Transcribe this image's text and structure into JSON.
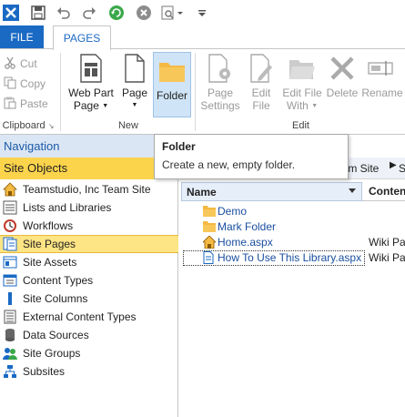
{
  "tabs": {
    "file": "FILE",
    "pages": "PAGES"
  },
  "clipboard": {
    "cut": "Cut",
    "copy": "Copy",
    "paste": "Paste",
    "label": "Clipboard"
  },
  "new_group": {
    "web_part_page_1": "Web Part",
    "web_part_page_2": "Page",
    "page": "Page",
    "folder": "Folder",
    "label": "New"
  },
  "edit_group": {
    "page_settings_1": "Page",
    "page_settings_2": "Settings",
    "edit_file_1": "Edit",
    "edit_file_2": "File",
    "edit_file_with_1": "Edit File",
    "edit_file_with_2": "With",
    "delete": "Delete",
    "rename": "Rename",
    "label": "Edit"
  },
  "tooltip": {
    "title": "Folder",
    "text": "Create a new, empty folder."
  },
  "navigation": {
    "header": "Navigation",
    "section": "Site Objects",
    "items": [
      {
        "label": "Teamstudio, Inc Team Site",
        "icon": "home-icon"
      },
      {
        "label": "Lists and Libraries",
        "icon": "list-icon"
      },
      {
        "label": "Workflows",
        "icon": "workflow-icon"
      },
      {
        "label": "Site Pages",
        "icon": "pages-icon",
        "selected": true
      },
      {
        "label": "Site Assets",
        "icon": "assets-icon"
      },
      {
        "label": "Content Types",
        "icon": "content-types-icon"
      },
      {
        "label": "Site Columns",
        "icon": "columns-icon"
      },
      {
        "label": "External Content Types",
        "icon": "external-content-icon"
      },
      {
        "label": "Data Sources",
        "icon": "database-icon"
      },
      {
        "label": "Site Groups",
        "icon": "groups-icon"
      },
      {
        "label": "Subsites",
        "icon": "subsites-icon"
      }
    ]
  },
  "breadcrumb": {
    "site": "eam Site",
    "next": "S"
  },
  "table": {
    "col_name": "Name",
    "col_content": "Content",
    "rows": [
      {
        "name": "Demo",
        "type": "",
        "icon": "folder-icon"
      },
      {
        "name": "Mark Folder",
        "type": "",
        "icon": "folder-icon"
      },
      {
        "name": "Home.aspx",
        "type": "Wiki Pag",
        "icon": "home-page-icon"
      },
      {
        "name": "How To Use This Library.aspx",
        "type": "Wiki Pag",
        "icon": "page-icon"
      }
    ]
  },
  "colors": {
    "accent": "#1a6ac4",
    "selection": "#fcd44c",
    "folder": "#f4b942"
  }
}
